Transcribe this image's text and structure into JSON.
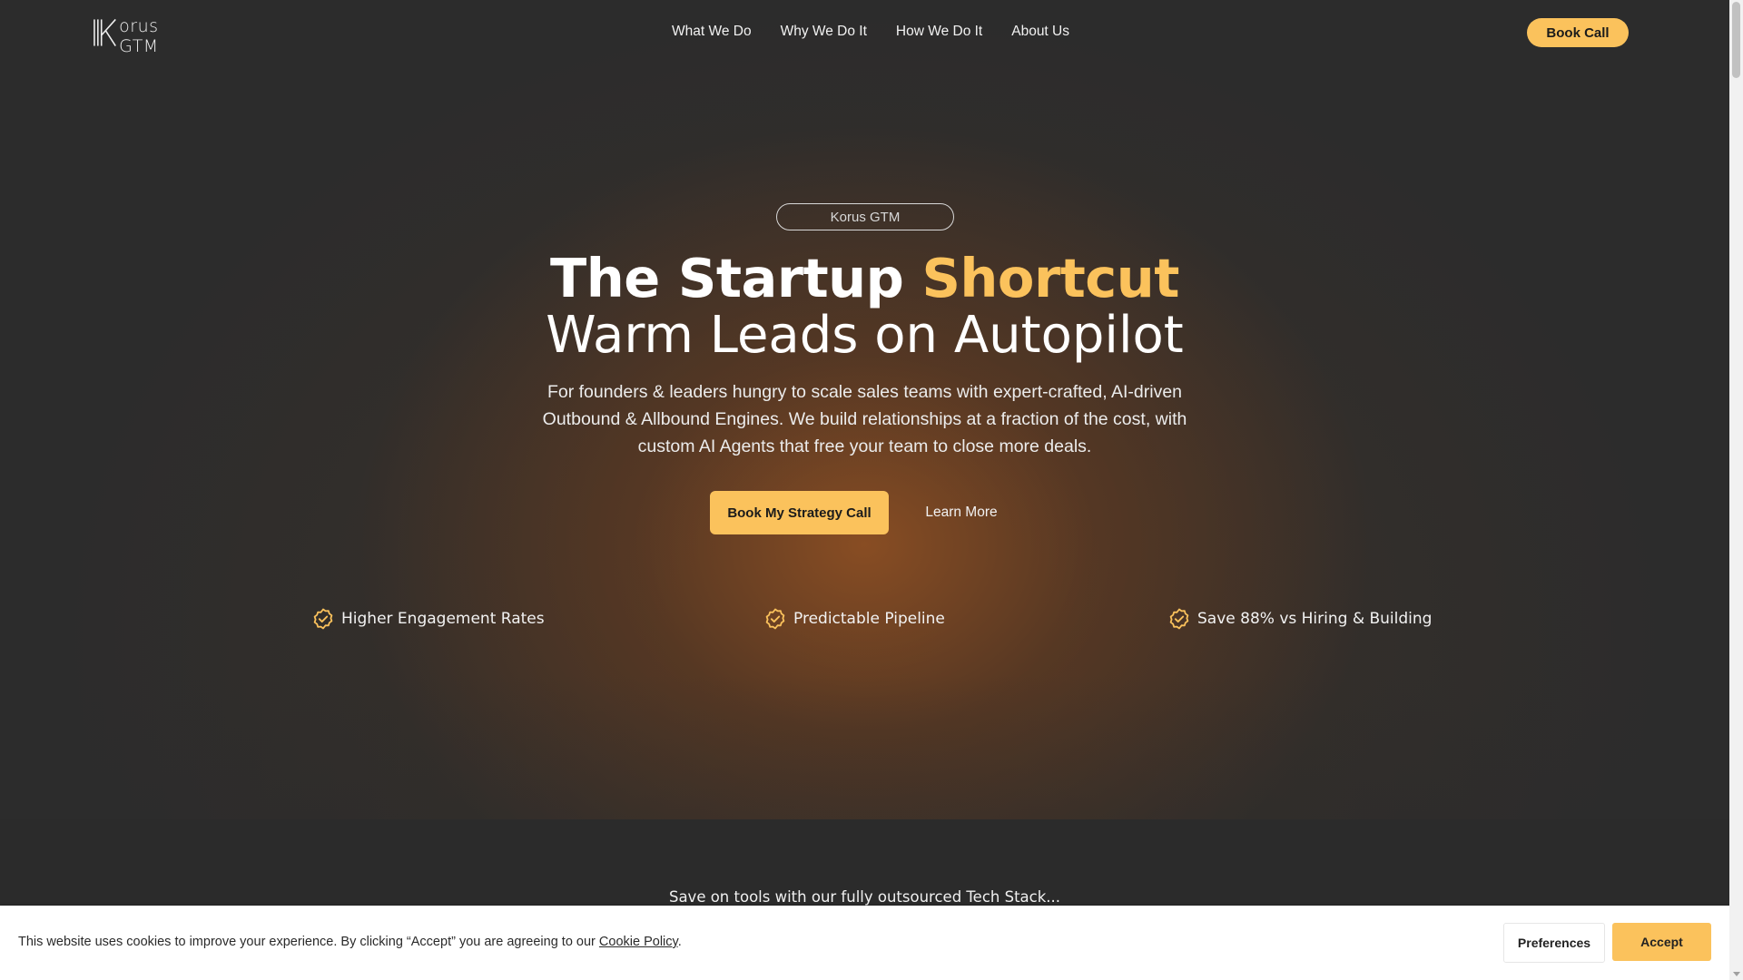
{
  "brand": {
    "logo_text": "orus GTM",
    "accent_color": "#fbc25c"
  },
  "nav": {
    "items": [
      {
        "label": "What We Do"
      },
      {
        "label": "Why We Do It"
      },
      {
        "label": "How We Do It"
      },
      {
        "label": "About Us"
      }
    ],
    "cta_label": "Book Call"
  },
  "hero": {
    "pill": "Korus GTM",
    "title_plain": "The Startup ",
    "title_accent": "Shortcut",
    "subtitle": "Warm Leads on Autopilot",
    "lead": "For founders & leaders hungry to scale sales teams with expert-crafted, AI-driven Outbound & Allbound Engines. We build relationships at a fraction of the cost, with custom AI Agents that free your team to close more deals.",
    "primary_cta": "Book My Strategy Call",
    "secondary_cta": "Learn More",
    "features": [
      {
        "label": "Higher Engagement Rates",
        "icon": "verified-badge-icon"
      },
      {
        "label": "Predictable Pipeline",
        "icon": "verified-badge-icon"
      },
      {
        "label": "Save 88% vs Hiring & Building",
        "icon": "verified-badge-icon"
      }
    ]
  },
  "tech": {
    "text": "Save on tools with our fully outsourced Tech Stack..."
  },
  "cookie": {
    "text_before": "This website uses cookies to improve your experience. By clicking “Accept” you are agreeing to our ",
    "link_label": "Cookie Policy",
    "text_after": ".",
    "preferences_label": "Preferences",
    "accept_label": "Accept"
  }
}
